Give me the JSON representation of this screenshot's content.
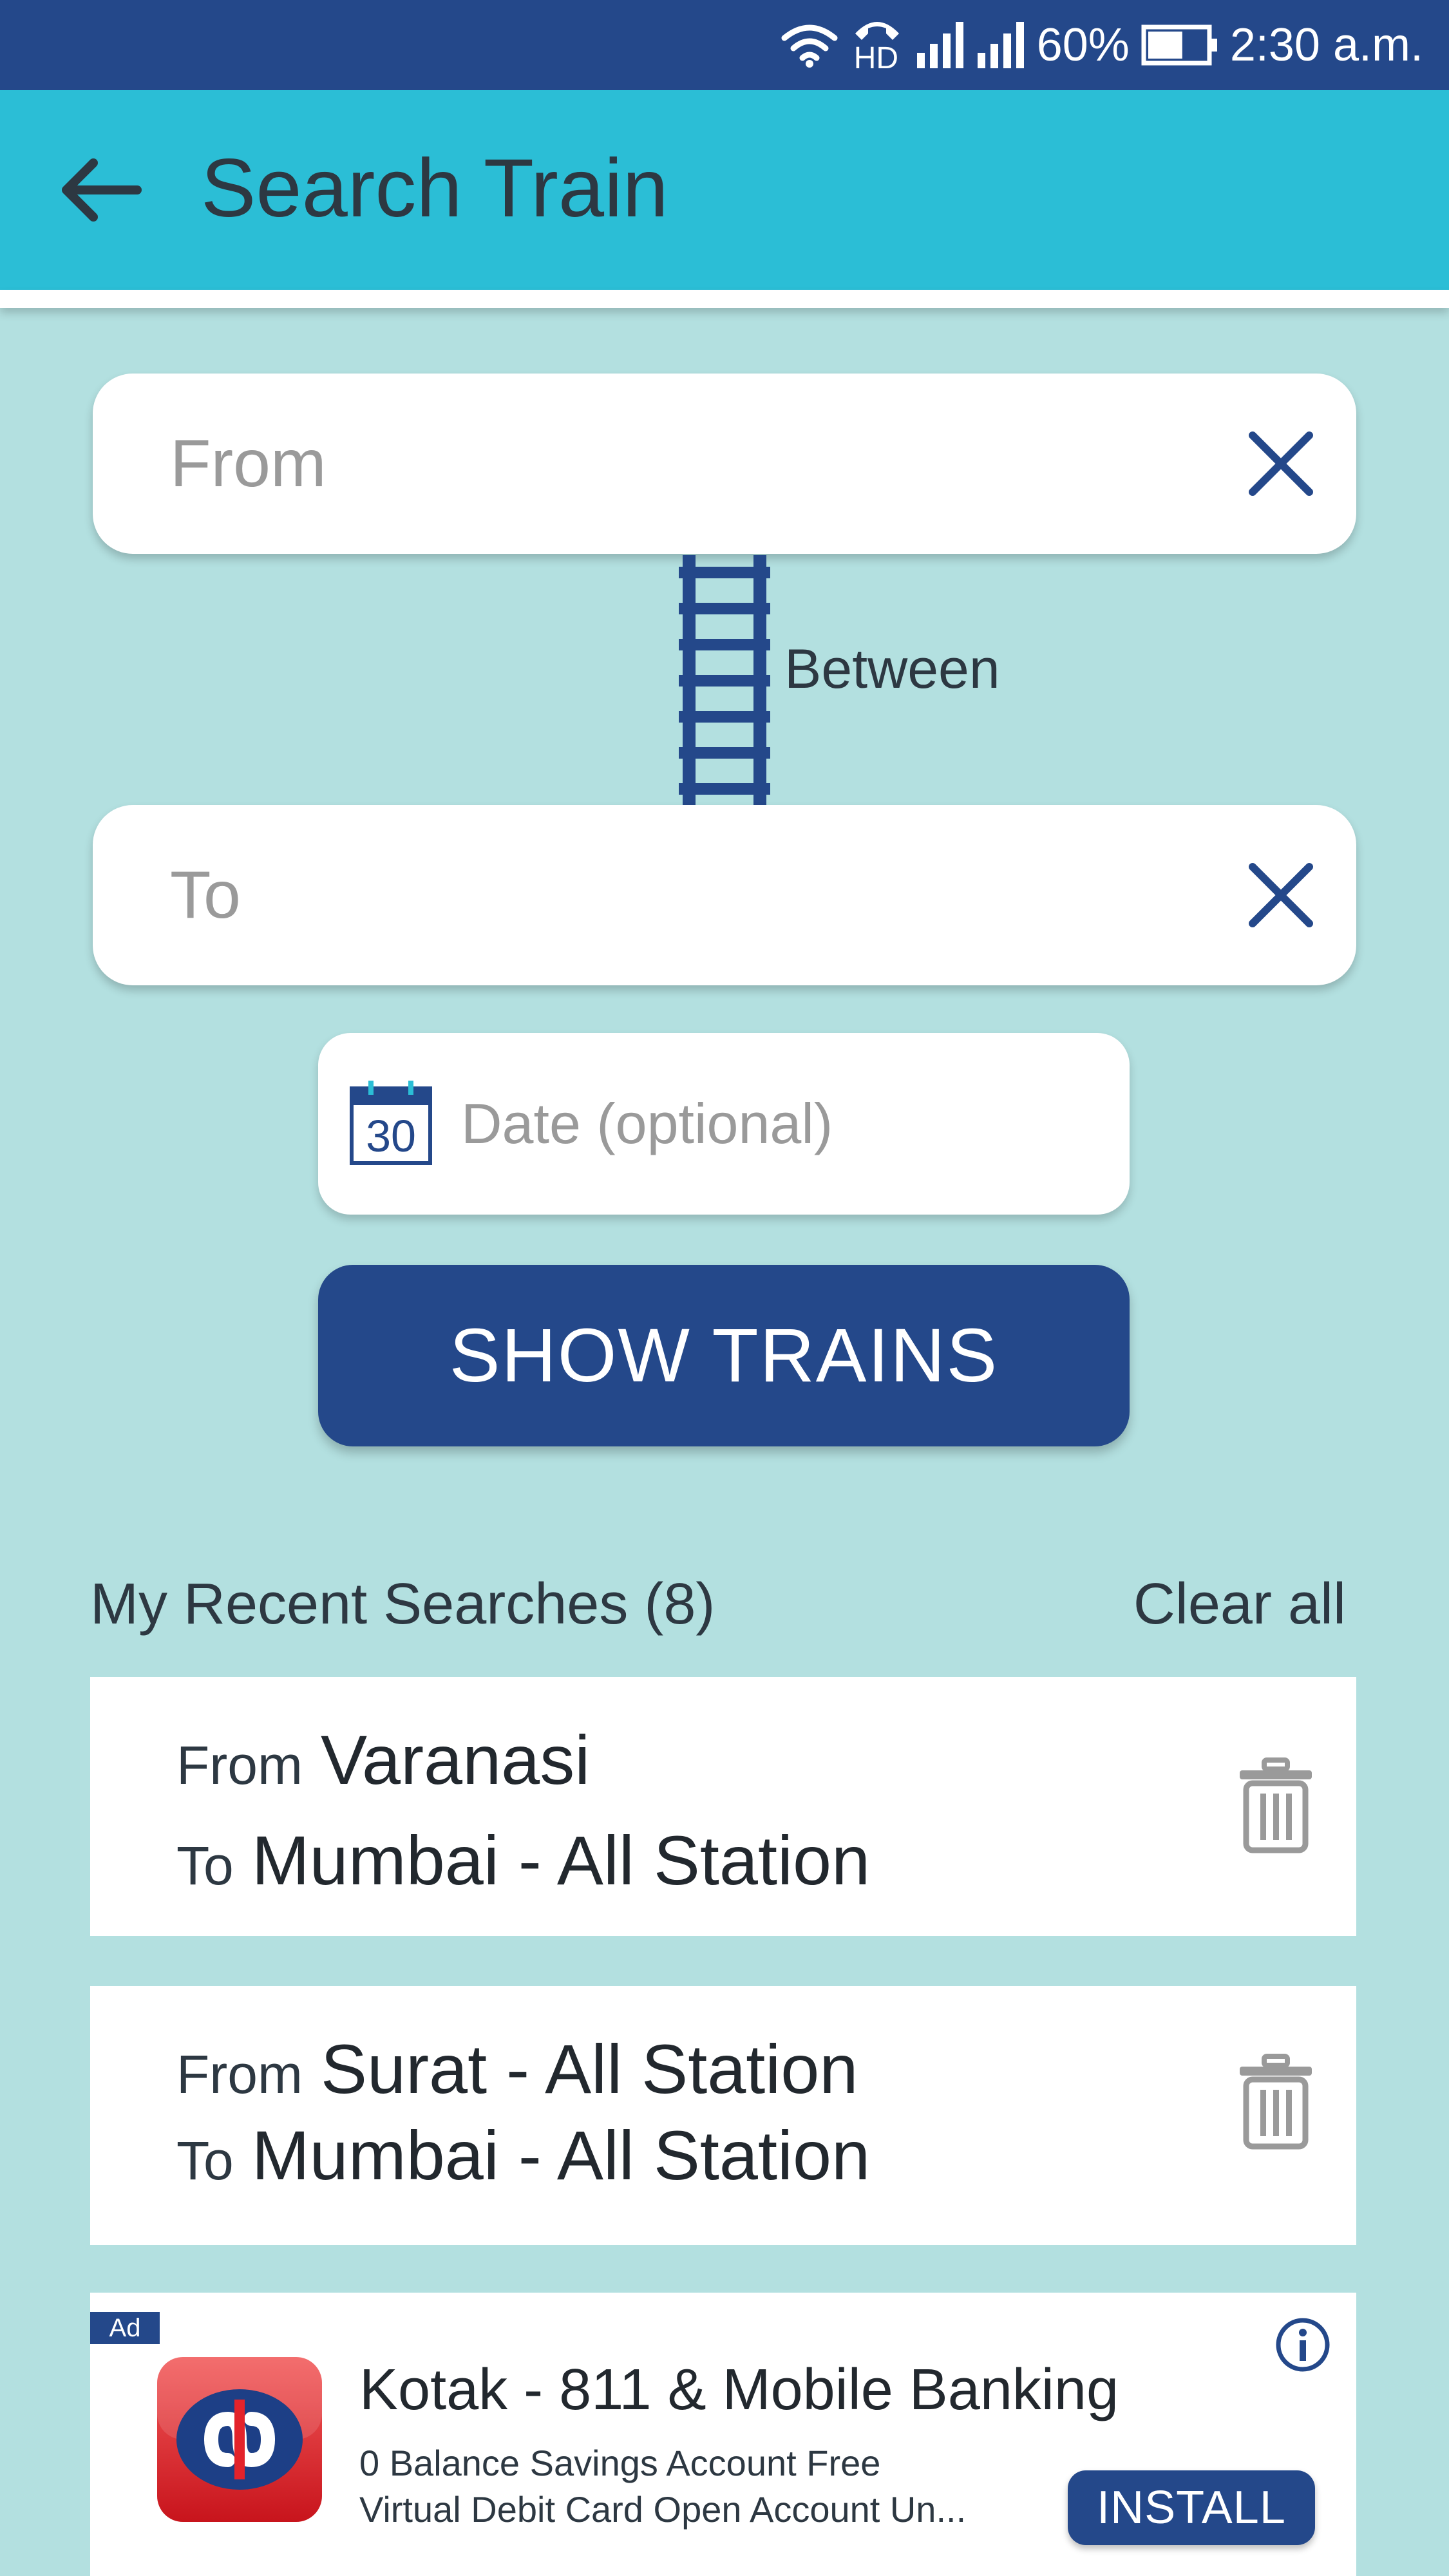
{
  "status_bar": {
    "hd_label": "HD",
    "battery_percent": "60%",
    "battery_level": 0.6,
    "time": "2:30 a.m."
  },
  "header": {
    "title": "Search Train"
  },
  "search": {
    "from_placeholder": "From",
    "to_placeholder": "To",
    "between_label": "Between",
    "date_placeholder": "Date (optional)",
    "calendar_day": "30",
    "submit_label": "SHOW TRAINS"
  },
  "recent": {
    "heading": "My Recent Searches (8)",
    "clear_label": "Clear all",
    "items": [
      {
        "from_label": "From",
        "from_value": "Varanasi",
        "to_label": "To",
        "to_value": "Mumbai - All Station"
      },
      {
        "from_label": "From",
        "from_value": "Surat - All Station",
        "to_label": "To",
        "to_value": "Mumbai - All Station"
      }
    ]
  },
  "ad": {
    "badge": "Ad",
    "title": "Kotak - 811 & Mobile Banking",
    "line1": "0 Balance Savings Account Free",
    "line2": "Virtual Debit Card  Open Account Un...",
    "install_label": "INSTALL"
  },
  "icons": {
    "status": [
      "wifi-icon",
      "hd-call-icon",
      "signal-icon",
      "battery-icon"
    ],
    "header": [
      "back-arrow-icon"
    ],
    "search": [
      "clear-icon",
      "railway-track-icon",
      "calendar-icon"
    ],
    "recent": [
      "trash-icon"
    ],
    "ad": [
      "info-icon",
      "kotak-logo"
    ]
  },
  "colors": {
    "status_bar": "#24488a",
    "app_bar": "#2bbed6",
    "background": "#b3e0e0",
    "primary": "#24488a",
    "placeholder": "#9a9a9a",
    "text": "#2d3842"
  }
}
